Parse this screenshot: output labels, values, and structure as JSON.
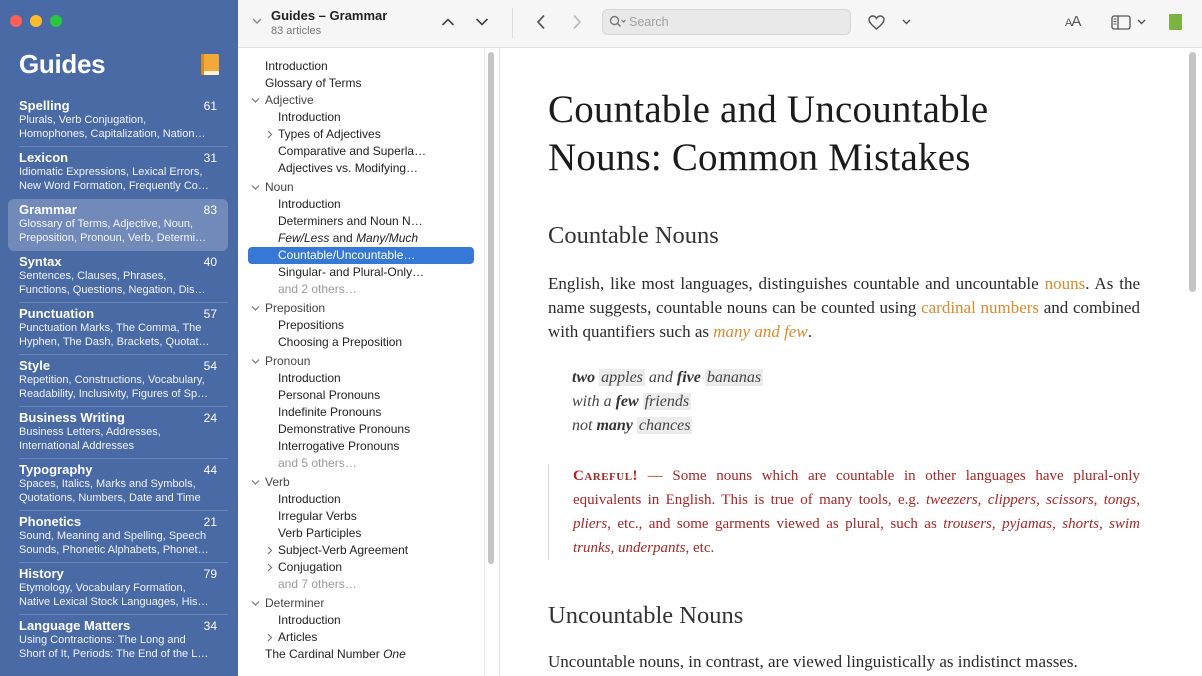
{
  "sidebar": {
    "title": "Guides",
    "items": [
      {
        "name": "Spelling",
        "count": "61",
        "desc1": "Plurals, Verb Conjugation,",
        "desc2": "Homophones, Capitalization, Nation…"
      },
      {
        "name": "Lexicon",
        "count": "31",
        "desc1": "Idiomatic Expressions, Lexical Errors,",
        "desc2": "New Word Formation, Frequently Co…"
      },
      {
        "name": "Grammar",
        "count": "83",
        "desc1": "Glossary of Terms, Adjective, Noun,",
        "desc2": "Preposition, Pronoun, Verb, Determi…"
      },
      {
        "name": "Syntax",
        "count": "40",
        "desc1": "Sentences, Clauses, Phrases,",
        "desc2": "Functions, Questions, Negation, Dis…"
      },
      {
        "name": "Punctuation",
        "count": "57",
        "desc1": "Punctuation Marks, The Comma, The",
        "desc2": "Hyphen, The Dash, Brackets, Quotat…"
      },
      {
        "name": "Style",
        "count": "54",
        "desc1": "Repetition, Constructions, Vocabulary,",
        "desc2": "Readability, Inclusivity, Figures of Sp…"
      },
      {
        "name": "Business Writing",
        "count": "24",
        "desc1": "Business Letters, Addresses,",
        "desc2": "International Addresses"
      },
      {
        "name": "Typography",
        "count": "44",
        "desc1": "Spaces, Italics, Marks and Symbols,",
        "desc2": "Quotations, Numbers, Date and Time"
      },
      {
        "name": "Phonetics",
        "count": "21",
        "desc1": "Sound, Meaning and Spelling, Speech",
        "desc2": "Sounds, Phonetic Alphabets, Phonet…"
      },
      {
        "name": "History",
        "count": "79",
        "desc1": "Etymology, Vocabulary Formation,",
        "desc2": "Native Lexical Stock Languages, His…"
      },
      {
        "name": "Language Matters",
        "count": "34",
        "desc1": "Using Contractions: The Long and",
        "desc2": "Short of It, Periods: The End of the L…"
      }
    ]
  },
  "toolbar": {
    "title": "Guides – Grammar",
    "subtitle": "83 articles",
    "search_placeholder": "Search",
    "font_size_label_big": "A",
    "font_size_label_small": "A"
  },
  "toc": {
    "items": [
      {
        "text": "Introduction"
      },
      {
        "text": "Glossary of Terms"
      },
      {
        "text": "Adjective"
      },
      {
        "text": "Introduction"
      },
      {
        "text": "Types of Adjectives"
      },
      {
        "text": "Comparative and Superla…"
      },
      {
        "text": "Adjectives vs. Modifying…"
      },
      {
        "text": "Noun"
      },
      {
        "text": "Introduction"
      },
      {
        "text": "Determiners and Noun N…"
      },
      {
        "p1": "Few/Less",
        "p2": " and ",
        "p3": "Many/Much"
      },
      {
        "text": "Countable/Uncountable…"
      },
      {
        "text": "Singular- and Plural-Only…"
      },
      {
        "text": "and 2 others…"
      },
      {
        "text": "Preposition"
      },
      {
        "text": "Prepositions"
      },
      {
        "text": "Choosing a Preposition"
      },
      {
        "text": "Pronoun"
      },
      {
        "text": "Introduction"
      },
      {
        "text": "Personal Pronouns"
      },
      {
        "text": "Indefinite Pronouns"
      },
      {
        "text": "Demonstrative Pronouns"
      },
      {
        "text": "Interrogative Pronouns"
      },
      {
        "text": "and 5 others…"
      },
      {
        "text": "Verb"
      },
      {
        "text": "Introduction"
      },
      {
        "text": "Irregular Verbs"
      },
      {
        "text": "Verb Participles"
      },
      {
        "text": "Subject-Verb Agreement"
      },
      {
        "text": "Conjugation"
      },
      {
        "text": "and 7 others…"
      },
      {
        "text": "Determiner"
      },
      {
        "text": "Introduction"
      },
      {
        "text": "Articles"
      },
      {
        "p1": "The Cardinal Number ",
        "p2": "One"
      }
    ]
  },
  "article": {
    "title_line1": "Countable and Uncountable",
    "title_line2": "Nouns: Common Mistakes",
    "h_countable": "Countable Nouns",
    "p1_a": "English, like most languages, distinguishes countable and uncountable ",
    "p1_link1": "nouns",
    "p1_b": ". As the name suggests, countable nouns can be counted using ",
    "p1_link2": "cardinal numbers",
    "p1_c": " and combined with quantifiers such as ",
    "p1_link3": "many and few",
    "p1_d": ".",
    "examples": [
      {
        "w1": "two",
        "w2": "apples",
        "w3": " and ",
        "w4": "five",
        "w5": "bananas"
      },
      {
        "w1": "with a ",
        "w2": "few",
        "w3": "friends"
      },
      {
        "w1": "not ",
        "w2": "many",
        "w3": "chances"
      }
    ],
    "careful_label": "Careful!",
    "careful_a": " — Some nouns which are countable in other languages have plural-only equivalents in English. This is true of many tools, e.g. ",
    "careful_tools": "tweezers, clippers, scissors, tongs, pliers",
    "careful_b": ", etc., and some garments viewed as plural, such as ",
    "careful_garments": "trousers, pyjamas, shorts, swim trunks, underpants",
    "careful_c": ", etc.",
    "h_uncountable": "Uncountable Nouns",
    "p2": "Uncountable nouns, in contrast, are viewed linguistically as indistinct masses."
  },
  "colors": {
    "sidebar_bg": "#4a6aa6",
    "selection_blue": "#3578d6",
    "link_orange": "#d98a2c",
    "careful_red": "#a82626"
  }
}
